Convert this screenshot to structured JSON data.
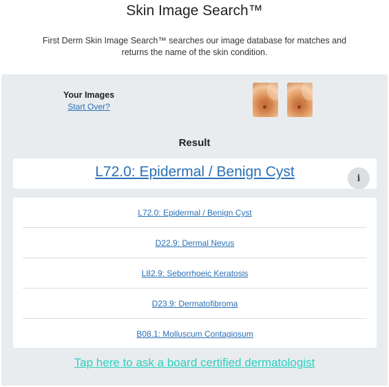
{
  "header": {
    "title": "Skin Image Search™",
    "description": "First Derm Skin Image Search™ searches our image database for matches and returns the name of the skin condition."
  },
  "your_images": {
    "label": "Your Images",
    "start_over": "Start Over?"
  },
  "result": {
    "heading": "Result",
    "top_match": "L72.0: Epidermal / Benign Cyst",
    "info_icon": "i"
  },
  "matches": [
    "L72.0: Epidermal / Benign Cyst",
    "D22.9: Dermal Nevus",
    "L82.9: Seborrhoeic Keratosis",
    "D23.9: Dermatofibroma",
    "B08.1: Molluscum Contagiosum"
  ],
  "ask_link": "Tap here to ask a board certified dermatologist",
  "colors": {
    "link": "#2a6fb5",
    "accent": "#2dcfc0",
    "panel_bg": "#e8ecef"
  }
}
